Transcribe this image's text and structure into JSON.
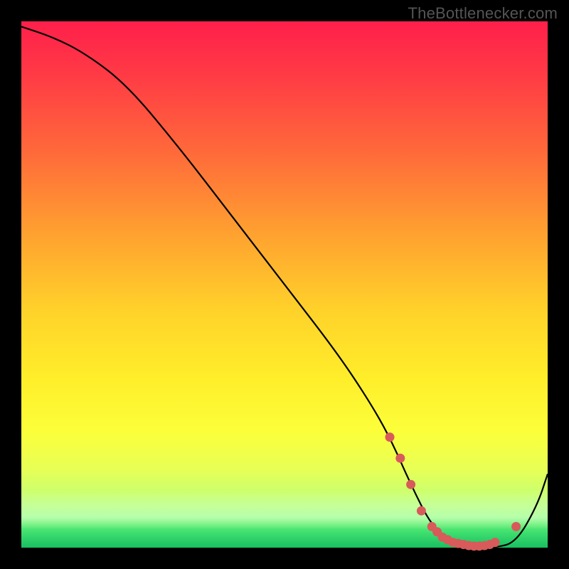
{
  "watermark": "TheBottlenecker.com",
  "chart_data": {
    "type": "line",
    "title": "",
    "xlabel": "",
    "ylabel": "",
    "xlim": [
      0,
      100
    ],
    "ylim": [
      0,
      100
    ],
    "series": [
      {
        "name": "bottleneck-curve",
        "x": [
          0,
          6,
          12,
          20,
          30,
          40,
          50,
          60,
          66,
          70,
          74,
          78,
          82,
          86,
          90,
          94,
          98,
          100
        ],
        "y": [
          99,
          97,
          94,
          88,
          76,
          63,
          50,
          37,
          28,
          21,
          12,
          4,
          1,
          0,
          0,
          1,
          8,
          14
        ]
      }
    ],
    "highlight_points": {
      "name": "optimal-range-dots",
      "x": [
        70,
        72,
        74,
        76,
        78,
        79,
        80,
        81,
        82,
        83,
        84,
        85,
        86,
        87,
        88,
        89,
        90,
        94
      ],
      "y": [
        21,
        17,
        12,
        7,
        4,
        3,
        2,
        1.5,
        1,
        0.8,
        0.6,
        0.4,
        0.3,
        0.3,
        0.4,
        0.6,
        1,
        4
      ]
    }
  }
}
